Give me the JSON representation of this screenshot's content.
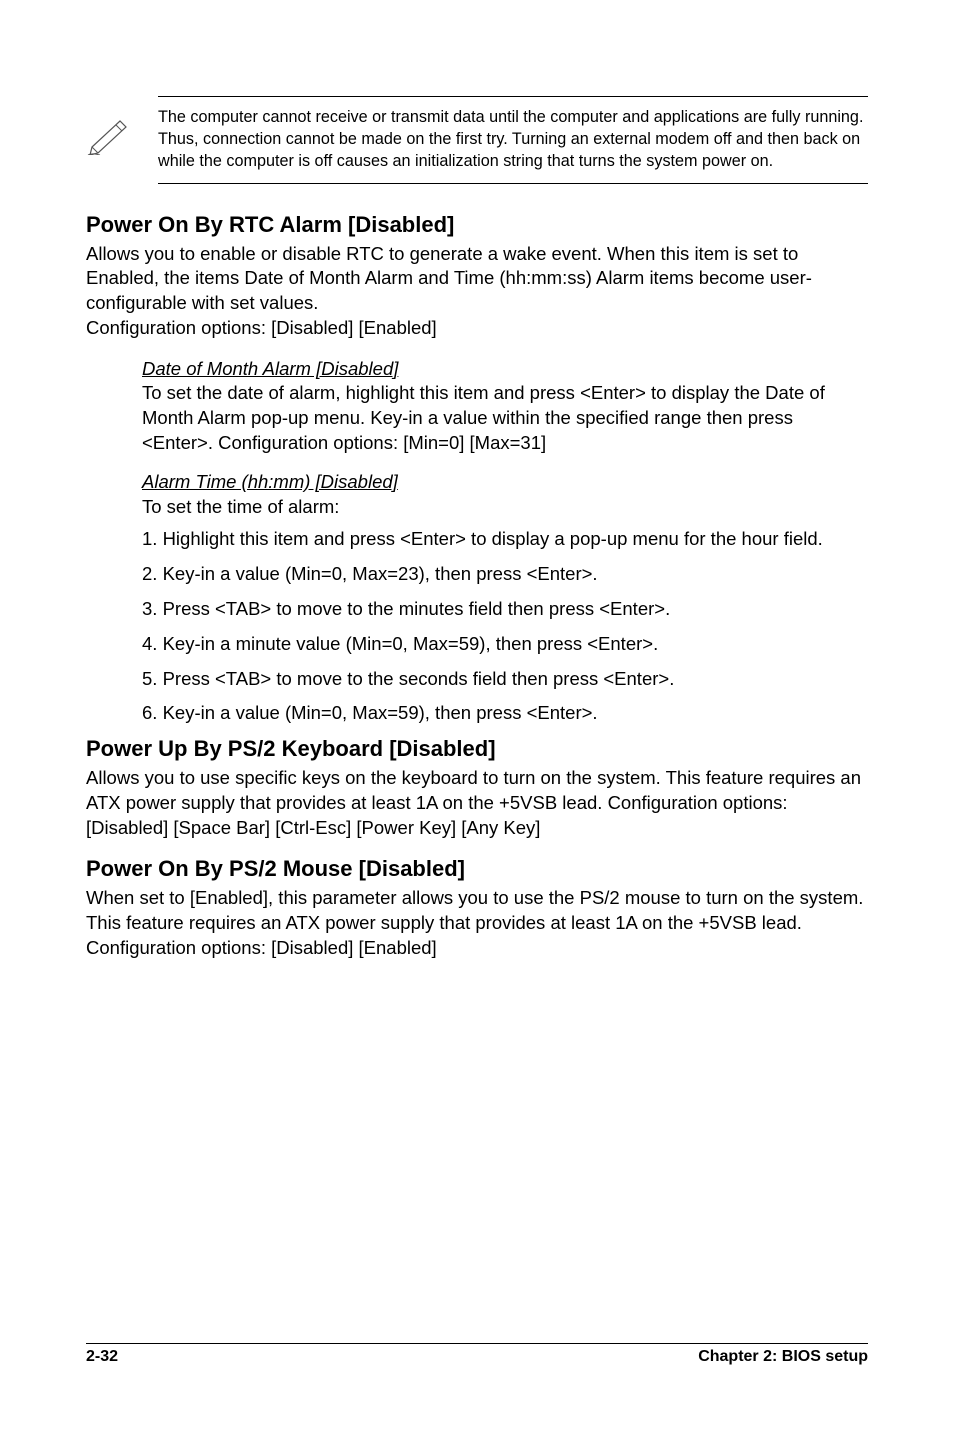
{
  "note": {
    "text": "The computer cannot receive or transmit data until the computer and applications are fully running. Thus, connection cannot be made on the first try. Turning an external modem off and then back on while the computer is off causes an initialization string that turns the system power on."
  },
  "sections": {
    "rtc": {
      "title": "Power On By RTC Alarm [Disabled]",
      "body": "Allows you to enable or disable RTC to generate a wake event. When this item is set to Enabled, the items Date of Month Alarm and Time (hh:mm:ss) Alarm items become user-configurable with set values.\nConfiguration options: [Disabled] [Enabled]",
      "sub1_title": "Date of Month Alarm [Disabled]",
      "sub1_body": "To set the date of alarm, highlight this item and press <Enter> to display the Date of Month Alarm pop-up menu. Key-in a value within the specified range then press <Enter>. Configuration options: [Min=0] [Max=31]",
      "sub2_title": "Alarm Time (hh:mm) [Disabled]",
      "sub2_body": "To set the time of alarm:",
      "steps": [
        "1. Highlight this item and press <Enter> to display a pop-up menu for the hour field.",
        "2. Key-in a value (Min=0, Max=23), then press <Enter>.",
        "3. Press <TAB> to move to the minutes field then press <Enter>.",
        "4. Key-in a minute value (Min=0, Max=59), then press <Enter>.",
        "5. Press <TAB> to move to the seconds field then press <Enter>.",
        "6. Key-in a value (Min=0, Max=59), then press <Enter>."
      ]
    },
    "kb": {
      "title": "Power Up By PS/2 Keyboard [Disabled]",
      "body": "Allows you to use specific keys on the keyboard to turn on the system. This feature requires an ATX power supply that provides at least 1A on the +5VSB lead. Configuration options: [Disabled] [Space Bar] [Ctrl-Esc] [Power Key] [Any Key]"
    },
    "mouse": {
      "title": "Power On By PS/2 Mouse [Disabled]",
      "body": "When set to [Enabled], this parameter allows you to use the PS/2 mouse to turn on the system. This feature requires an ATX power supply that provides at least 1A on the +5VSB lead. Configuration options: [Disabled] [Enabled]"
    }
  },
  "footer": {
    "left": "2-32",
    "right": "Chapter 2: BIOS setup"
  }
}
